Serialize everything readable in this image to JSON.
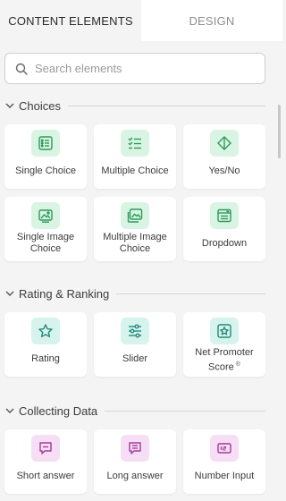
{
  "tabs": [
    {
      "label": "CONTENT ELEMENTS",
      "active": true
    },
    {
      "label": "DESIGN",
      "active": false
    }
  ],
  "search": {
    "placeholder": "Search elements",
    "value": ""
  },
  "sections": [
    {
      "title": "Choices",
      "items": [
        {
          "label": "Single Choice",
          "icon": "single-choice-icon"
        },
        {
          "label": "Multiple Choice",
          "icon": "multiple-choice-icon"
        },
        {
          "label": "Yes/No",
          "icon": "yes-no-icon"
        },
        {
          "label": "Single Image Choice",
          "icon": "single-image-icon"
        },
        {
          "label": "Multiple Image Choice",
          "icon": "multiple-image-icon"
        },
        {
          "label": "Dropdown",
          "icon": "dropdown-icon"
        }
      ]
    },
    {
      "title": "Rating & Ranking",
      "items": [
        {
          "label": "Rating",
          "icon": "star-icon"
        },
        {
          "label": "Slider",
          "icon": "slider-icon"
        },
        {
          "label": "Net Promoter Score",
          "sup": "®",
          "icon": "nps-icon"
        }
      ]
    },
    {
      "title": "Collecting Data",
      "items": [
        {
          "label": "Short answer",
          "icon": "short-answer-icon"
        },
        {
          "label": "Long answer",
          "icon": "long-answer-icon"
        },
        {
          "label": "Number Input",
          "icon": "number-input-icon"
        }
      ]
    }
  ],
  "colors": {
    "choices_icon_bg": "#d9f4e3",
    "choices_icon_stroke": "#2e9a5c",
    "rating_icon_bg": "#d6f3ee",
    "rating_icon_stroke": "#228a7a",
    "data_icon_bg": "#f6dff5",
    "data_icon_stroke": "#a3399c"
  }
}
